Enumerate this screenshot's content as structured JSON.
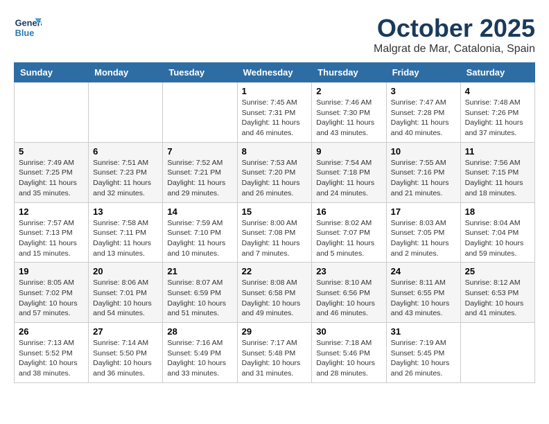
{
  "logo": {
    "line1": "General",
    "line2": "Blue"
  },
  "title": "October 2025",
  "location": "Malgrat de Mar, Catalonia, Spain",
  "weekdays": [
    "Sunday",
    "Monday",
    "Tuesday",
    "Wednesday",
    "Thursday",
    "Friday",
    "Saturday"
  ],
  "weeks": [
    [
      null,
      null,
      null,
      {
        "day": "1",
        "sunrise": "Sunrise: 7:45 AM",
        "sunset": "Sunset: 7:31 PM",
        "daylight": "Daylight: 11 hours and 46 minutes."
      },
      {
        "day": "2",
        "sunrise": "Sunrise: 7:46 AM",
        "sunset": "Sunset: 7:30 PM",
        "daylight": "Daylight: 11 hours and 43 minutes."
      },
      {
        "day": "3",
        "sunrise": "Sunrise: 7:47 AM",
        "sunset": "Sunset: 7:28 PM",
        "daylight": "Daylight: 11 hours and 40 minutes."
      },
      {
        "day": "4",
        "sunrise": "Sunrise: 7:48 AM",
        "sunset": "Sunset: 7:26 PM",
        "daylight": "Daylight: 11 hours and 37 minutes."
      }
    ],
    [
      {
        "day": "5",
        "sunrise": "Sunrise: 7:49 AM",
        "sunset": "Sunset: 7:25 PM",
        "daylight": "Daylight: 11 hours and 35 minutes."
      },
      {
        "day": "6",
        "sunrise": "Sunrise: 7:51 AM",
        "sunset": "Sunset: 7:23 PM",
        "daylight": "Daylight: 11 hours and 32 minutes."
      },
      {
        "day": "7",
        "sunrise": "Sunrise: 7:52 AM",
        "sunset": "Sunset: 7:21 PM",
        "daylight": "Daylight: 11 hours and 29 minutes."
      },
      {
        "day": "8",
        "sunrise": "Sunrise: 7:53 AM",
        "sunset": "Sunset: 7:20 PM",
        "daylight": "Daylight: 11 hours and 26 minutes."
      },
      {
        "day": "9",
        "sunrise": "Sunrise: 7:54 AM",
        "sunset": "Sunset: 7:18 PM",
        "daylight": "Daylight: 11 hours and 24 minutes."
      },
      {
        "day": "10",
        "sunrise": "Sunrise: 7:55 AM",
        "sunset": "Sunset: 7:16 PM",
        "daylight": "Daylight: 11 hours and 21 minutes."
      },
      {
        "day": "11",
        "sunrise": "Sunrise: 7:56 AM",
        "sunset": "Sunset: 7:15 PM",
        "daylight": "Daylight: 11 hours and 18 minutes."
      }
    ],
    [
      {
        "day": "12",
        "sunrise": "Sunrise: 7:57 AM",
        "sunset": "Sunset: 7:13 PM",
        "daylight": "Daylight: 11 hours and 15 minutes."
      },
      {
        "day": "13",
        "sunrise": "Sunrise: 7:58 AM",
        "sunset": "Sunset: 7:11 PM",
        "daylight": "Daylight: 11 hours and 13 minutes."
      },
      {
        "day": "14",
        "sunrise": "Sunrise: 7:59 AM",
        "sunset": "Sunset: 7:10 PM",
        "daylight": "Daylight: 11 hours and 10 minutes."
      },
      {
        "day": "15",
        "sunrise": "Sunrise: 8:00 AM",
        "sunset": "Sunset: 7:08 PM",
        "daylight": "Daylight: 11 hours and 7 minutes."
      },
      {
        "day": "16",
        "sunrise": "Sunrise: 8:02 AM",
        "sunset": "Sunset: 7:07 PM",
        "daylight": "Daylight: 11 hours and 5 minutes."
      },
      {
        "day": "17",
        "sunrise": "Sunrise: 8:03 AM",
        "sunset": "Sunset: 7:05 PM",
        "daylight": "Daylight: 11 hours and 2 minutes."
      },
      {
        "day": "18",
        "sunrise": "Sunrise: 8:04 AM",
        "sunset": "Sunset: 7:04 PM",
        "daylight": "Daylight: 10 hours and 59 minutes."
      }
    ],
    [
      {
        "day": "19",
        "sunrise": "Sunrise: 8:05 AM",
        "sunset": "Sunset: 7:02 PM",
        "daylight": "Daylight: 10 hours and 57 minutes."
      },
      {
        "day": "20",
        "sunrise": "Sunrise: 8:06 AM",
        "sunset": "Sunset: 7:01 PM",
        "daylight": "Daylight: 10 hours and 54 minutes."
      },
      {
        "day": "21",
        "sunrise": "Sunrise: 8:07 AM",
        "sunset": "Sunset: 6:59 PM",
        "daylight": "Daylight: 10 hours and 51 minutes."
      },
      {
        "day": "22",
        "sunrise": "Sunrise: 8:08 AM",
        "sunset": "Sunset: 6:58 PM",
        "daylight": "Daylight: 10 hours and 49 minutes."
      },
      {
        "day": "23",
        "sunrise": "Sunrise: 8:10 AM",
        "sunset": "Sunset: 6:56 PM",
        "daylight": "Daylight: 10 hours and 46 minutes."
      },
      {
        "day": "24",
        "sunrise": "Sunrise: 8:11 AM",
        "sunset": "Sunset: 6:55 PM",
        "daylight": "Daylight: 10 hours and 43 minutes."
      },
      {
        "day": "25",
        "sunrise": "Sunrise: 8:12 AM",
        "sunset": "Sunset: 6:53 PM",
        "daylight": "Daylight: 10 hours and 41 minutes."
      }
    ],
    [
      {
        "day": "26",
        "sunrise": "Sunrise: 7:13 AM",
        "sunset": "Sunset: 5:52 PM",
        "daylight": "Daylight: 10 hours and 38 minutes."
      },
      {
        "day": "27",
        "sunrise": "Sunrise: 7:14 AM",
        "sunset": "Sunset: 5:50 PM",
        "daylight": "Daylight: 10 hours and 36 minutes."
      },
      {
        "day": "28",
        "sunrise": "Sunrise: 7:16 AM",
        "sunset": "Sunset: 5:49 PM",
        "daylight": "Daylight: 10 hours and 33 minutes."
      },
      {
        "day": "29",
        "sunrise": "Sunrise: 7:17 AM",
        "sunset": "Sunset: 5:48 PM",
        "daylight": "Daylight: 10 hours and 31 minutes."
      },
      {
        "day": "30",
        "sunrise": "Sunrise: 7:18 AM",
        "sunset": "Sunset: 5:46 PM",
        "daylight": "Daylight: 10 hours and 28 minutes."
      },
      {
        "day": "31",
        "sunrise": "Sunrise: 7:19 AM",
        "sunset": "Sunset: 5:45 PM",
        "daylight": "Daylight: 10 hours and 26 minutes."
      },
      null
    ]
  ]
}
